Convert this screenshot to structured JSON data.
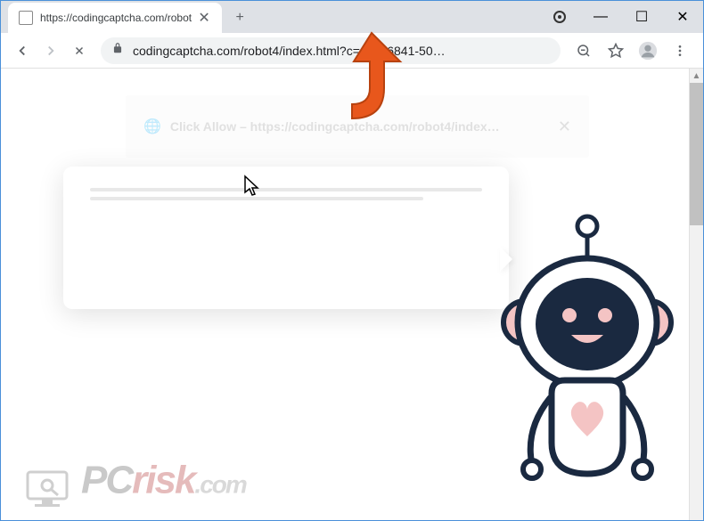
{
  "window": {
    "minimize": "—",
    "maximize": "☐",
    "close": "✕"
  },
  "tab": {
    "title": "https://codingcaptcha.com/robot",
    "close": "✕",
    "newtab": "+"
  },
  "toolbar": {
    "back": "←",
    "forward": "→",
    "reload": "✕",
    "url": "codingcaptcha.com/robot4/index.html?c=c5a76841-50…",
    "zoom": "⊖",
    "star": "☆",
    "menu": "⋮"
  },
  "ghost_dialog": {
    "title": "Click Allow – https://codingcaptcha.com/robot4/index…",
    "close": "✕"
  },
  "watermark": {
    "pc": "PC",
    "risk": "risk",
    "com": ".com"
  },
  "colors": {
    "arrow": "#e8571c",
    "robot_dark": "#1a2940",
    "robot_pink": "#f4c4c4"
  }
}
